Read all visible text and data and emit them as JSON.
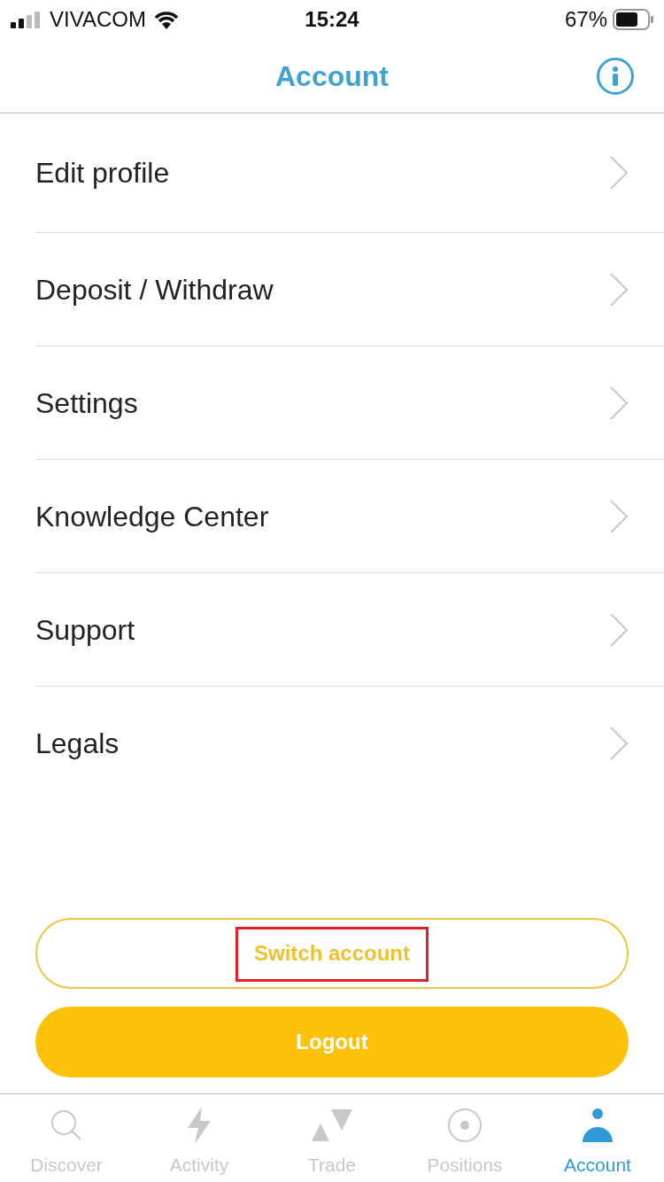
{
  "status_bar": {
    "carrier": "VIVACOM",
    "time": "15:24",
    "battery": "67%"
  },
  "header": {
    "title": "Account"
  },
  "menu_items": [
    {
      "label": "Edit profile"
    },
    {
      "label": "Deposit / Withdraw"
    },
    {
      "label": "Settings"
    },
    {
      "label": "Knowledge Center"
    },
    {
      "label": "Support"
    },
    {
      "label": "Legals"
    }
  ],
  "switch_button": {
    "label": "Switch account",
    "highlighted": true
  },
  "logout_button": {
    "label": "Logout"
  },
  "tabs": [
    {
      "kind": "discover",
      "label": "Discover",
      "selected": false
    },
    {
      "kind": "activity",
      "label": "Activity",
      "selected": false
    },
    {
      "kind": "trade",
      "label": "Trade",
      "selected": false
    },
    {
      "kind": "positions",
      "label": "Positions",
      "selected": false
    },
    {
      "kind": "account",
      "label": "Account",
      "selected": true
    }
  ]
}
